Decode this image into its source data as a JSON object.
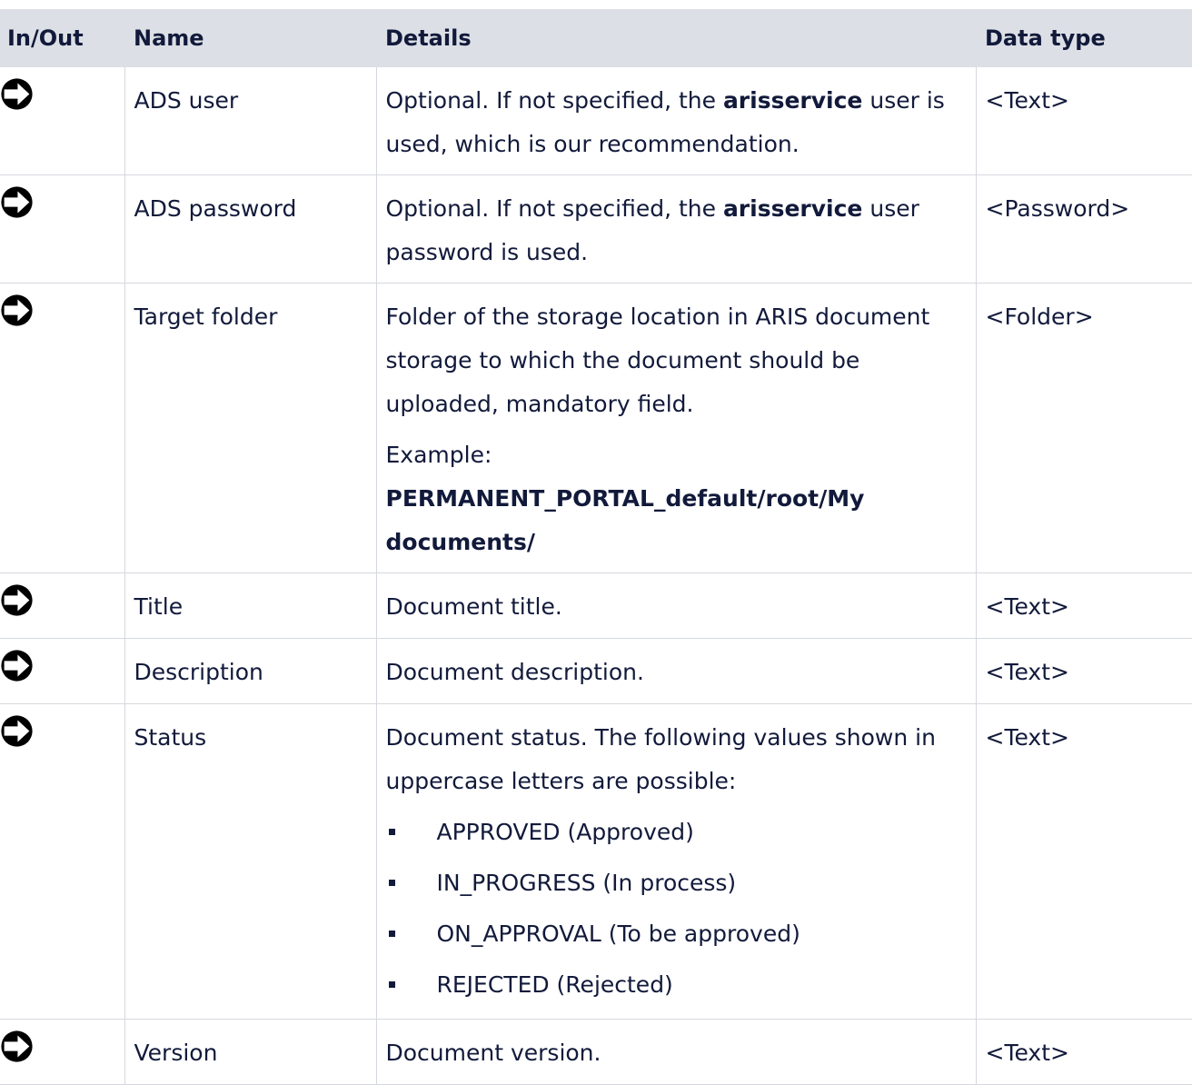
{
  "headers": {
    "inout": "In/Out",
    "name": "Name",
    "details": "Details",
    "datatype": "Data type"
  },
  "icon": "arrow-right-circle-icon",
  "rows": [
    {
      "name": "ADS user",
      "details": {
        "pre": "Optional. If not specified, the ",
        "bold": "arisservice",
        "post": " user is used, which is our recommendation."
      },
      "type": "<Text>"
    },
    {
      "name": "ADS password",
      "details": {
        "pre": "Optional. If not specified, the ",
        "bold": "arisservice",
        "post": " user password is used."
      },
      "type": "<Password>"
    },
    {
      "name": "Target folder",
      "details": {
        "text": "Folder of the storage location in ARIS document storage to which the document should be uploaded, mandatory field.",
        "example_label": "Example:",
        "example_value": "PERMANENT_PORTAL_default/root/My documents/"
      },
      "type": "<Folder>"
    },
    {
      "name": "Title",
      "details": {
        "text": "Document title."
      },
      "type": "<Text>"
    },
    {
      "name": "Description",
      "details": {
        "text": "Document description."
      },
      "type": "<Text>"
    },
    {
      "name": "Status",
      "details": {
        "text": "Document status. The following values shown in uppercase letters are possible:",
        "bullets": [
          "APPROVED (Approved)",
          "IN_PROGRESS (In process)",
          "ON_APPROVAL (To be approved)",
          "REJECTED (Rejected)"
        ]
      },
      "type": "<Text>"
    },
    {
      "name": "Version",
      "details": {
        "text": "Document version."
      },
      "type": "<Text>"
    }
  ]
}
